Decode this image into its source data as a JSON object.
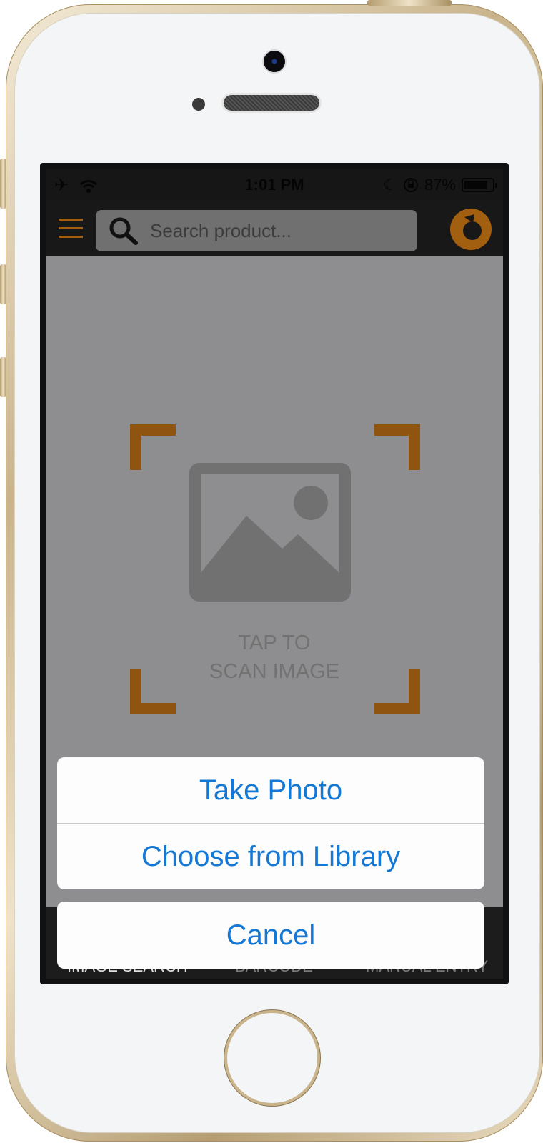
{
  "status_bar": {
    "time": "1:01 PM",
    "battery_percent": "87%",
    "battery_level": 0.87,
    "icons": [
      "airplane-icon",
      "wifi-icon",
      "moon-icon",
      "rotation-lock-icon",
      "battery-icon"
    ]
  },
  "header": {
    "search_placeholder": "Search product...",
    "menu_icon": "hamburger-menu-icon",
    "logo_icon": "brand-logo-icon"
  },
  "scanner": {
    "line1": "TAP TO",
    "line2": "SCAN IMAGE",
    "icon": "image-placeholder-icon"
  },
  "tabs": [
    {
      "label": "IMAGE SEARCH"
    },
    {
      "label": "BARCODE"
    },
    {
      "label": "MANUAL ENTRY"
    }
  ],
  "action_sheet": {
    "take_photo": "Take Photo",
    "choose_library": "Choose from Library",
    "cancel": "Cancel"
  },
  "colors": {
    "accent": "#a35f10",
    "action_blue": "#1478d4",
    "overlay_gray": "#8e8e90"
  }
}
